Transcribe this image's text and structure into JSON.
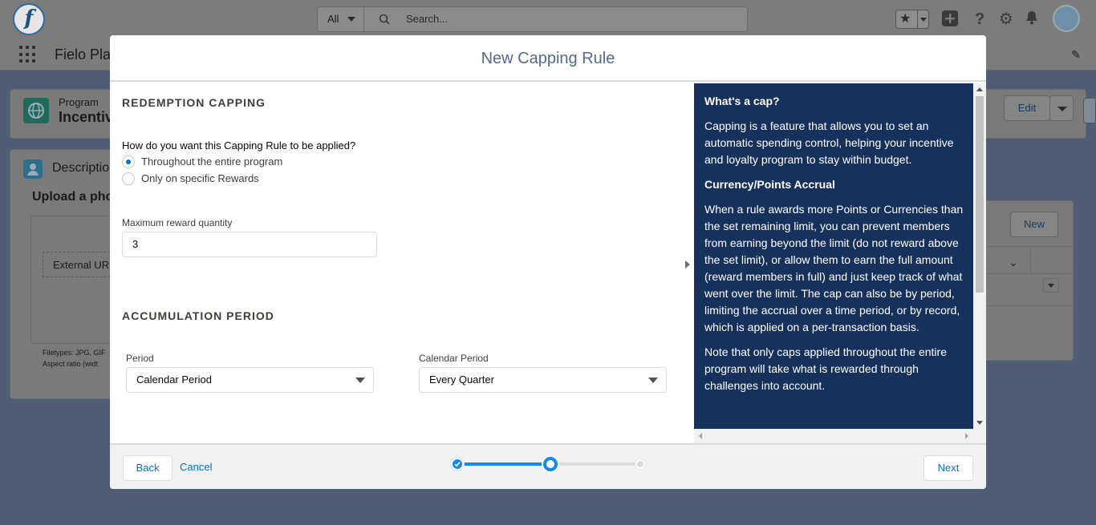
{
  "background": {
    "global_search": {
      "scope": "All",
      "placeholder": "Search..."
    },
    "app_name": "Fielo Pla",
    "record": {
      "type": "Program",
      "name": "Incentiv",
      "edit_label": "Edit"
    },
    "description_card": {
      "title": "Description",
      "upload_heading": "Upload a pho",
      "external_url_label": "External UR",
      "file_types": "Filetypes: JPG, GIF",
      "aspect_ratio": "Aspect ratio (widt"
    },
    "related": {
      "new_label": "New"
    }
  },
  "modal": {
    "title": "New Capping Rule",
    "redemption": {
      "section_title": "REDEMPTION CAPPING",
      "question": "How do you want this Capping Rule to be applied?",
      "options": [
        {
          "label": "Throughout the entire program",
          "checked": true
        },
        {
          "label": "Only on specific Rewards",
          "checked": false
        }
      ],
      "max_label": "Maximum reward quantity",
      "max_value": "3"
    },
    "accumulation": {
      "section_title": "ACCUMULATION PERIOD",
      "period_label": "Period",
      "period_value": "Calendar Period",
      "calendar_label": "Calendar Period",
      "calendar_value": "Every Quarter"
    },
    "help": {
      "heading1": "What's a cap?",
      "para1": "Capping is a feature that allows you to set an automatic spending control, helping your incentive and loyalty program to stay within budget.",
      "heading2": "Currency/Points Accrual",
      "para2": "When a rule awards more Points or Currencies than the set remaining limit, you can prevent members from earning beyond the limit (do not reward above the set limit), or allow them to earn the full amount (reward members in full) and just keep track of what went over the limit. The cap can also be by period, limiting the accrual over a time period, or by record, which is applied on a per-transaction basis.",
      "para3": "Note that only caps applied throughout the entire program will take what is rewarded through challenges into account."
    },
    "footer": {
      "back_label": "Back",
      "cancel_label": "Cancel",
      "next_label": "Next",
      "steps_total": 3,
      "current_step": 2
    }
  },
  "colors": {
    "brand": "#0070d2",
    "progress": "#1589ee",
    "help_bg": "#16325c"
  }
}
